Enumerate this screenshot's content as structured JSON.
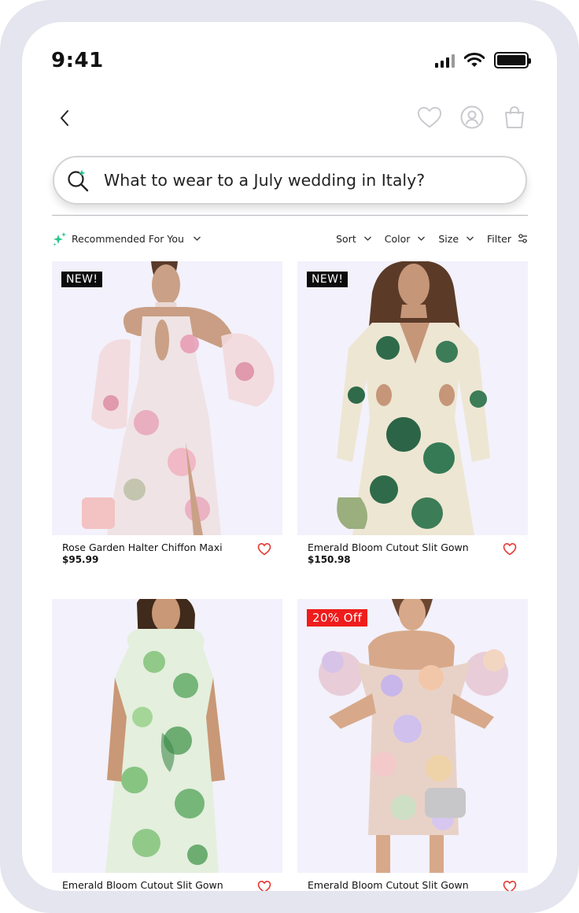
{
  "status_bar": {
    "time": "9:41"
  },
  "search": {
    "query": "What to wear to a July wedding in Italy?"
  },
  "filter_bar": {
    "recommended_label": "Recommended For You",
    "sort_label": "Sort",
    "color_label": "Color",
    "size_label": "Size",
    "filter_label": "Filter"
  },
  "colors": {
    "accent_ai": "#2bc48a",
    "sale_badge": "#ef1c1c",
    "new_badge": "#0b0b0b",
    "heart": "#e53935",
    "image_bg": "#f3f1fb"
  },
  "products": [
    {
      "badge": "NEW!",
      "name": "Rose Garden Halter Chiffon Maxi",
      "price": "$95.99"
    },
    {
      "badge": "NEW!",
      "name": "Emerald Bloom Cutout Slit Gown",
      "price": "$150.98"
    },
    {
      "badge": "",
      "name": "Emerald Bloom Cutout Slit Gown",
      "price": ""
    },
    {
      "badge": "20% Off",
      "name": "Emerald Bloom Cutout Slit Gown",
      "price": ""
    }
  ]
}
